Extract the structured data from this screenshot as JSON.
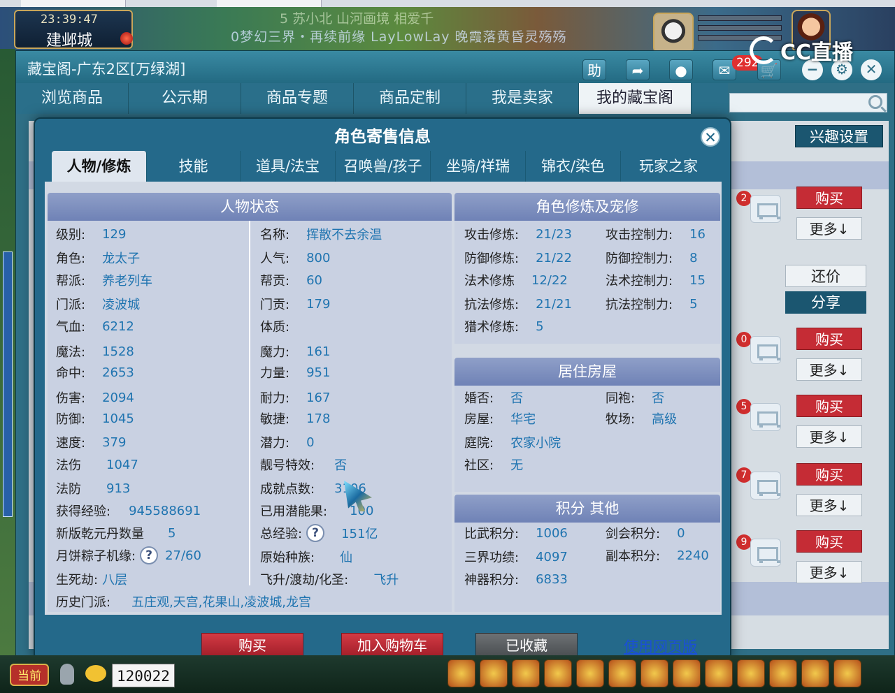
{
  "game": {
    "clock": "23:39:47",
    "city": "建邺城",
    "banner_line1": "5 苏小北 山河画境 相爱千",
    "banner_line2": "0梦幻三界・再续前缘 LayLowLay 晚霞落黄昏灵殇殇"
  },
  "stream_logo": "CC直播",
  "cbg": {
    "title": "藏宝阁-广东2区[万绿湖]",
    "help_label": "助",
    "message_count": "292",
    "nav": [
      "浏览商品",
      "公示期",
      "商品专题",
      "商品定制",
      "我是卖家",
      "我的藏宝阁"
    ],
    "interest_label": "兴趣设置",
    "bargain_label": "还价",
    "share_label": "分享",
    "rows": [
      {
        "num": "2",
        "buy": "购买",
        "more": "更多↓"
      },
      {
        "num": "0",
        "buy": "购买",
        "more": "更多↓"
      },
      {
        "num": "5",
        "buy": "购买",
        "more": "更多↓"
      },
      {
        "num": "7",
        "buy": "购买",
        "more": "更多↓"
      },
      {
        "num": "9",
        "buy": "购买",
        "more": "更多↓"
      }
    ]
  },
  "modal": {
    "title": "角色寄售信息",
    "close_label": "✕",
    "tabs": [
      "人物/修炼",
      "技能",
      "道具/法宝",
      "召唤兽/孩子",
      "坐骑/祥瑞",
      "锦衣/染色",
      "玩家之家"
    ],
    "status": {
      "heading": "人物状态",
      "level_label": "级别:",
      "level": "129",
      "role_label": "角色:",
      "role": "龙太子",
      "gang_label": "帮派:",
      "gang": "养老列车",
      "school_label": "门派:",
      "school": "凌波城",
      "hp_label": "气血:",
      "hp": "6212",
      "mp_label": "魔法:",
      "mp": "1528",
      "hit_label": "命中:",
      "hit": "2653",
      "damage_label": "伤害:",
      "damage": "2094",
      "defense_label": "防御:",
      "defense": "1045",
      "speed_label": "速度:",
      "speed": "379",
      "mag_dmg_label": "法伤",
      "mag_dmg": "1047",
      "mag_def_label": "法防",
      "mag_def": "913",
      "exp_label": "获得经验:",
      "exp": "945588691",
      "qianyuan_label": "新版乾元丹数量",
      "qianyuan": "5",
      "zongzi_label": "月饼粽子机缘:",
      "zongzi": "27/60",
      "shengsi_label": "生死劫:",
      "shengsi": "八层",
      "history_label": "历史门派:",
      "history": "五庄观,天宫,花果山,凌波城,龙宫",
      "name_label": "名称:",
      "name": "挥散不去余温",
      "pop_label": "人气:",
      "pop": "800",
      "gang_contrib_label": "帮贡:",
      "gang_contrib": "60",
      "school_contrib_label": "门贡:",
      "school_contrib": "179",
      "physique_label": "体质:",
      "magic_label": "魔力:",
      "magic": "161",
      "strength_label": "力量:",
      "strength": "951",
      "endurance_label": "耐力:",
      "endurance": "167",
      "agility_label": "敏捷:",
      "agility": "178",
      "potential_label": "潜力:",
      "potential": "0",
      "pretty_label": "靓号特效:",
      "pretty": "否",
      "achieve_label": "成就点数:",
      "achieve": "3106",
      "used_pot_label": "已用潜能果:",
      "used_pot": "100",
      "total_exp_label": "总经验:",
      "total_exp": "151亿",
      "race_label": "原始种族:",
      "race": "仙",
      "fly_label": "飞升/渡劫/化圣:",
      "fly": "飞升"
    },
    "cultivation": {
      "heading": "角色修炼及宠修",
      "atk_label": "攻击修炼:",
      "atk": "21/23",
      "def_label": "防御修炼:",
      "def": "21/22",
      "mag_label": "法术修炼",
      "mag": "12/22",
      "resist_label": "抗法修炼:",
      "resist": "21/21",
      "hunt_label": "猎术修炼:",
      "hunt": "5",
      "atk_ctl_label": "攻击控制力:",
      "atk_ctl": "16",
      "def_ctl_label": "防御控制力:",
      "def_ctl": "8",
      "mag_ctl_label": "法术控制力:",
      "mag_ctl": "15",
      "res_ctl_label": "抗法控制力:",
      "res_ctl": "5"
    },
    "housing": {
      "heading": "居住房屋",
      "married_label": "婚否:",
      "married": "否",
      "house_label": "房屋:",
      "house": "华宅",
      "yard_label": "庭院:",
      "yard": "农家小院",
      "community_label": "社区:",
      "community": "无",
      "robe_label": "同袍:",
      "robe": "否",
      "ranch_label": "牧场:",
      "ranch": "高级"
    },
    "points": {
      "heading": "积分 其他",
      "arena_label": "比武积分:",
      "arena": "1006",
      "merit_label": "三界功绩:",
      "merit": "4097",
      "artifact_label": "神器积分:",
      "artifact": "6833",
      "sword_label": "剑会积分:",
      "sword": "0",
      "dungeon_label": "副本积分:",
      "dungeon": "2240"
    },
    "actions": {
      "buy": "购买",
      "add_cart": "加入购物车",
      "favorited": "已收藏",
      "web_version": "使用网页版"
    }
  },
  "chat": {
    "channel": "当前",
    "input_value": "120022"
  },
  "colors": {
    "accent": "#24698a",
    "value_blue": "#1f74b0",
    "buy_red": "#c52c35"
  }
}
